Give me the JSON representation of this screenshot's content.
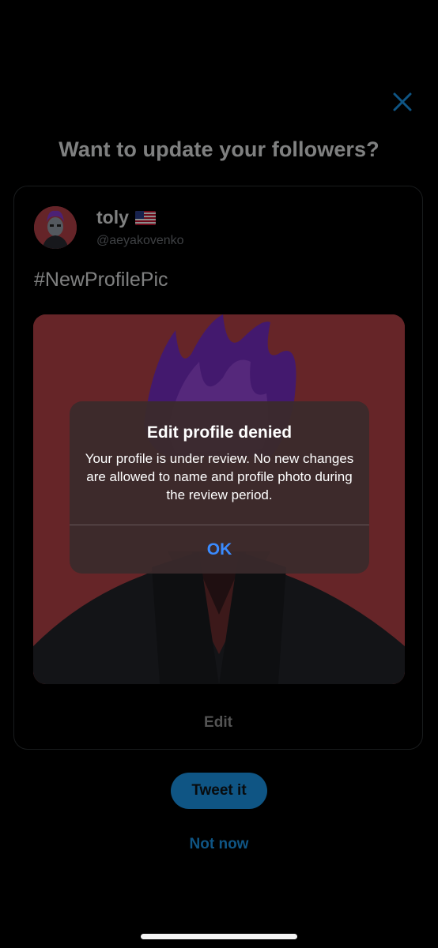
{
  "header": {
    "title": "Want to update your followers?",
    "close_icon": "close-icon"
  },
  "tweet": {
    "display_name": "toly",
    "flag_icon": "us-flag-icon",
    "handle": "@aeyakovenko",
    "text": "#NewProfilePic",
    "edit_label": "Edit"
  },
  "actions": {
    "tweet_label": "Tweet it",
    "not_now_label": "Not now"
  },
  "alert": {
    "title": "Edit profile denied",
    "message": "Your profile is under review. No new changes are allowed to name and profile photo during the review period.",
    "ok_label": "OK"
  },
  "colors": {
    "background": "#000000",
    "accent": "#1d9bf0",
    "alert_button": "#3a8bff",
    "image_background": "#c0474c"
  }
}
